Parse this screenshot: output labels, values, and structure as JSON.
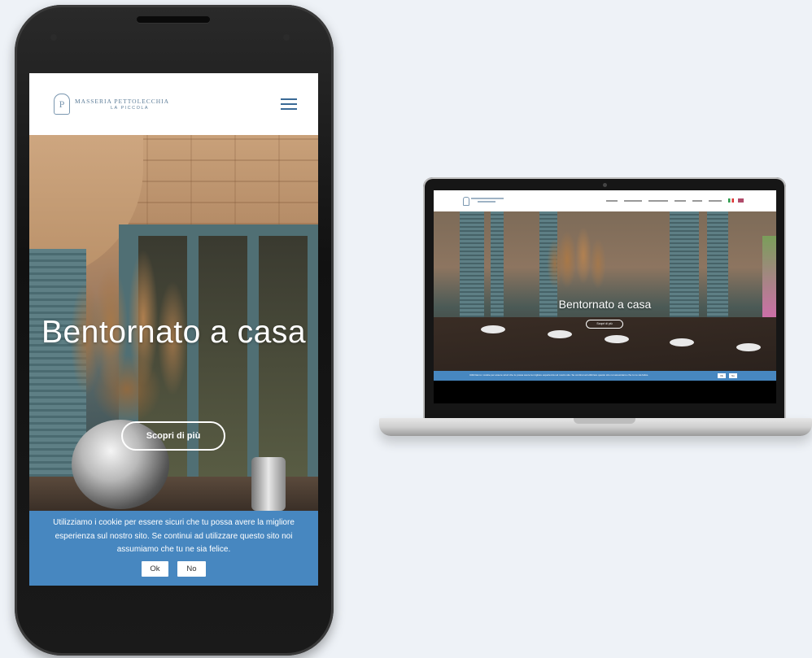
{
  "brand": {
    "monogram": "P",
    "name": "MASSERIA PETTOLECCHIA",
    "tagline": "LA PICCOLA"
  },
  "hero": {
    "title": "Bentornato a casa",
    "button_label": "Scopri di più"
  },
  "cookie": {
    "text": "Utilizziamo i cookie per essere sicuri che tu possa avere la migliore esperienza sul nostro sito. Se continui ad utilizzare questo sito noi assumiamo che tu ne sia felice.",
    "ok_label": "Ok",
    "no_label": "No"
  },
  "desktop": {
    "hero_title": "Bentornato a casa",
    "hero_button_label": "Scopri di più"
  },
  "colors": {
    "cookie_bar": "#4787c0",
    "brand_text": "#5d7d98",
    "hamburger": "#3a6a96"
  },
  "icons": {
    "menu": "hamburger-icon",
    "logo": "shield-monogram-icon"
  }
}
